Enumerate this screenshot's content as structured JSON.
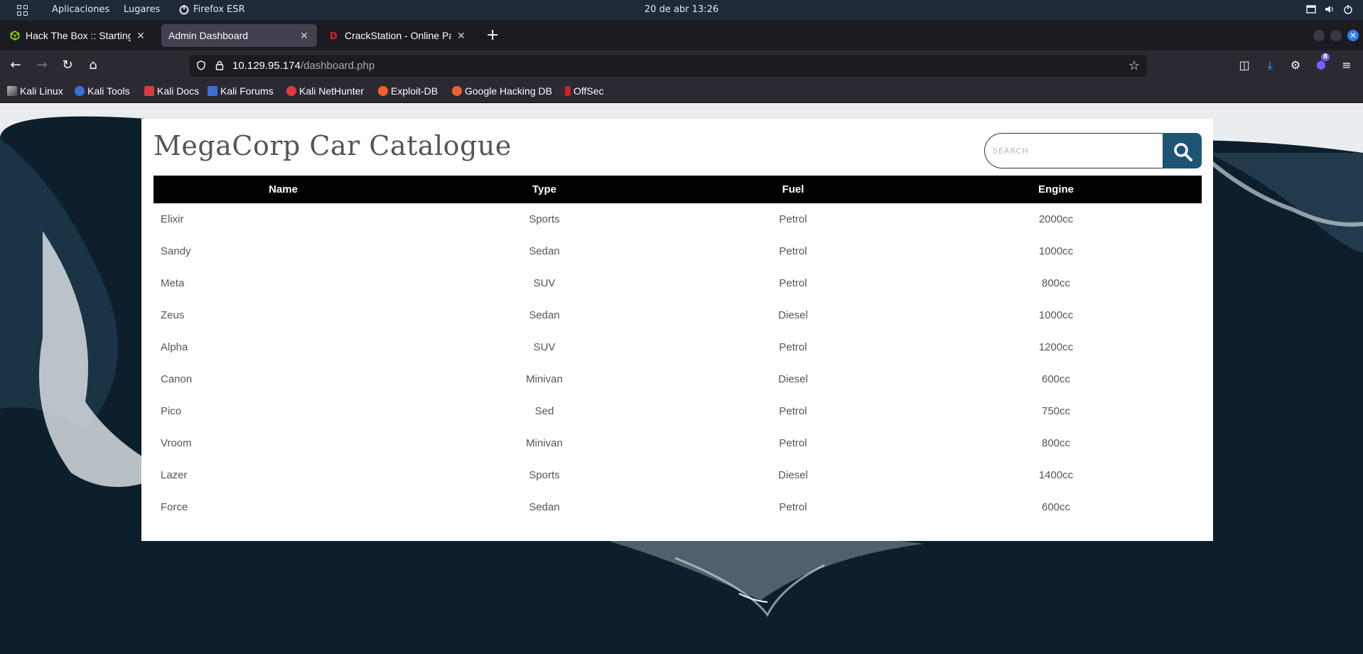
{
  "system_bar": {
    "apps_label": "Aplicaciones",
    "places_label": "Lugares",
    "browser_label": "Firefox ESR",
    "datetime": "20 de abr  13:26"
  },
  "tabs": [
    {
      "title": "Hack The Box :: Starting Point",
      "active": false
    },
    {
      "title": "Admin Dashboard",
      "active": true
    },
    {
      "title": "CrackStation - Online Password Hash Cracking",
      "active": false
    }
  ],
  "urlbar": {
    "host": "10.129.95.174",
    "path": "/dashboard.php"
  },
  "nav": {
    "extension_badge": "8"
  },
  "bookmarks": [
    {
      "label": "Kali Linux",
      "icon": "kali-dragon-icon"
    },
    {
      "label": "Kali Tools",
      "icon": "kali-tools-icon"
    },
    {
      "label": "Kali Docs",
      "icon": "kali-docs-icon"
    },
    {
      "label": "Kali Forums",
      "icon": "kali-forums-icon"
    },
    {
      "label": "Kali NetHunter",
      "icon": "nethunter-icon"
    },
    {
      "label": "Exploit-DB",
      "icon": "exploit-db-icon"
    },
    {
      "label": "Google Hacking DB",
      "icon": "ghdb-icon"
    },
    {
      "label": "OffSec",
      "icon": "offsec-icon"
    }
  ],
  "page": {
    "title": "MegaCorp Car Catalogue",
    "search": {
      "placeholder": "SEARCH"
    },
    "table": {
      "headers": [
        "Name",
        "Type",
        "Fuel",
        "Engine"
      ],
      "rows": [
        [
          "Elixir",
          "Sports",
          "Petrol",
          "2000cc"
        ],
        [
          "Sandy",
          "Sedan",
          "Petrol",
          "1000cc"
        ],
        [
          "Meta",
          "SUV",
          "Petrol",
          "800cc"
        ],
        [
          "Zeus",
          "Sedan",
          "Diesel",
          "1000cc"
        ],
        [
          "Alpha",
          "SUV",
          "Petrol",
          "1200cc"
        ],
        [
          "Canon",
          "Minivan",
          "Diesel",
          "600cc"
        ],
        [
          "Pico",
          "Sed",
          "Petrol",
          "750cc"
        ],
        [
          "Vroom",
          "Minivan",
          "Petrol",
          "800cc"
        ],
        [
          "Lazer",
          "Sports",
          "Diesel",
          "1400cc"
        ],
        [
          "Force",
          "Sedan",
          "Petrol",
          "600cc"
        ]
      ]
    }
  },
  "colors": {
    "accent": "#1d5474",
    "table_header": "#000000",
    "tab_active": "#42414d"
  }
}
